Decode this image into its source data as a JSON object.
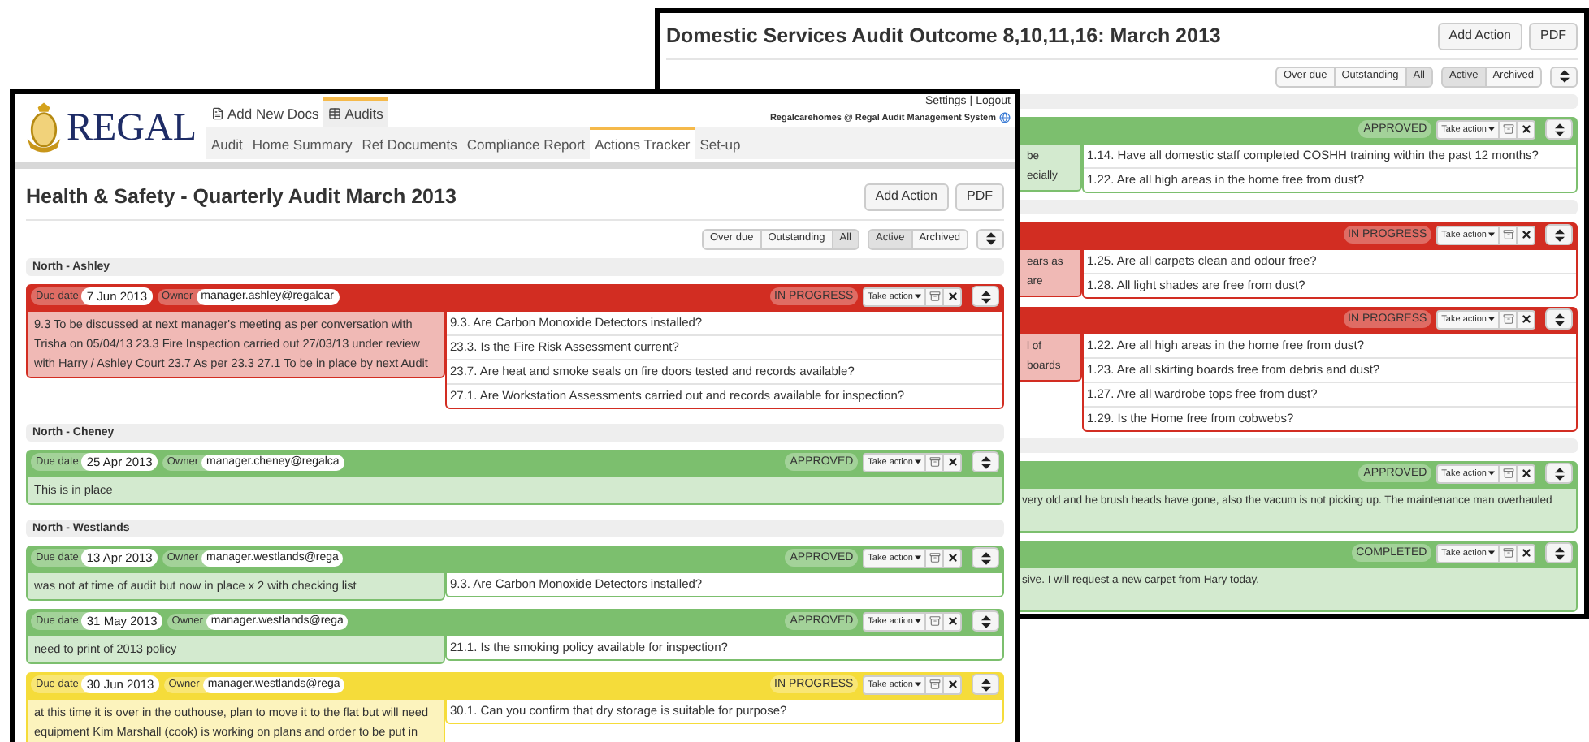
{
  "back_window": {
    "title": "Domestic Services Audit Outcome 8,10,11,16: March 2013",
    "buttons": [
      "Add Action",
      "PDF"
    ],
    "filters": [
      {
        "label": "Over due",
        "selected": false
      },
      {
        "label": "Outstanding",
        "selected": false
      },
      {
        "label": "All",
        "selected": true
      }
    ],
    "status_filters": [
      {
        "label": "Active",
        "selected": true
      },
      {
        "label": "Archived",
        "selected": false
      }
    ],
    "sections": [
      {
        "cards": [
          {
            "color": "#7cbf6e",
            "status": "APPROVED",
            "action_label": "Take action",
            "note_fragments": [
              "be",
              "ecially"
            ],
            "questions": [
              "1.14. Have all domestic staff completed COSHH training within the past 12 months?",
              "1.22. Are all high areas in the home free from dust?"
            ]
          }
        ]
      },
      {
        "cards": [
          {
            "color": "#d22d22",
            "status": "IN PROGRESS",
            "action_label": "Take action",
            "note_fragments": [
              "ears as",
              "are"
            ],
            "questions": [
              "1.25. Are all carpets clean and odour free?",
              "1.28. All light shades are free from dust?"
            ]
          },
          {
            "color": "#d22d22",
            "status": "IN PROGRESS",
            "action_label": "Take action",
            "note_fragments": [
              "l of",
              "boards"
            ],
            "questions": [
              "1.22. Are all high areas in the home free from dust?",
              "1.23. Are all skirting boards free from debris and dust?",
              "1.27. Are all wardrobe tops free from dust?",
              "1.29. Is the Home free from cobwebs?"
            ]
          }
        ]
      },
      {
        "cards": [
          {
            "color": "#7cbf6e",
            "status": "APPROVED",
            "action_label": "Take action",
            "note_fragments": [
              "very old and he brush heads have gone, also the vacum is not picking up. The maintenance man overhauled"
            ]
          },
          {
            "color": "#7cbf6e",
            "status": "COMPLETED",
            "action_label": "Take action",
            "note_fragments": [
              "sive. I will request a new carpet from Hary today."
            ]
          }
        ]
      }
    ]
  },
  "front_window": {
    "logo": "REGAL",
    "top_tabs": [
      {
        "label": "Add New Docs",
        "selected": false
      },
      {
        "label": "Audits",
        "selected": true
      }
    ],
    "nav": [
      {
        "label": "Audit",
        "selected": false
      },
      {
        "label": "Home Summary",
        "selected": false
      },
      {
        "label": "Ref Documents",
        "selected": false
      },
      {
        "label": "Compliance Report",
        "selected": false
      },
      {
        "label": "Actions Tracker",
        "selected": true
      },
      {
        "label": "Set-up",
        "selected": false
      }
    ],
    "settings_link": "Settings",
    "logout_link": "Logout",
    "separator": "|",
    "account": "Regalcarehomes @ Regal Audit Management System",
    "title": "Health & Safety - Quarterly Audit March 2013",
    "buttons": [
      "Add Action",
      "PDF"
    ],
    "filters": [
      {
        "label": "Over due",
        "selected": false
      },
      {
        "label": "Outstanding",
        "selected": false
      },
      {
        "label": "All",
        "selected": true
      }
    ],
    "status_filters": [
      {
        "label": "Active",
        "selected": true
      },
      {
        "label": "Archived",
        "selected": false
      }
    ],
    "sections": [
      {
        "name": "North - Ashley",
        "cards": [
          {
            "color": "#d22d22",
            "due_label": "Due date",
            "due_date": "7 Jun 2013",
            "owner_label": "Owner",
            "owner": "manager.ashley@regalcar",
            "status": "IN PROGRESS",
            "action_label": "Take action",
            "note": "9.3 To be discussed at next manager's meeting as per conversation with Trisha on 05/04/13 23.3 Fire Inspection carried out 27/03/13 under review with Harry / Ashley Court 23.7 As per 23.3 27.1 To be in place by next Audit",
            "questions": [
              "9.3. Are Carbon Monoxide Detectors installed?",
              "23.3. Is the Fire Risk Assessment current?",
              "23.7. Are heat and smoke seals on fire doors tested and records available?",
              "27.1. Are Workstation Assessments carried out and records available for inspection?"
            ]
          }
        ]
      },
      {
        "name": "North - Cheney",
        "cards": [
          {
            "color": "#7cbf6e",
            "due_label": "Due date",
            "due_date": "25 Apr 2013",
            "owner_label": "Owner",
            "owner": "manager.cheney@regalca",
            "status": "APPROVED",
            "action_label": "Take action",
            "note": "This is in place"
          }
        ]
      },
      {
        "name": "North - Westlands",
        "cards": [
          {
            "color": "#7cbf6e",
            "due_label": "Due date",
            "due_date": "13 Apr 2013",
            "owner_label": "Owner",
            "owner": "manager.westlands@rega",
            "status": "APPROVED",
            "action_label": "Take action",
            "note": "was not at time of audit but now in place x 2 with checking list",
            "questions": [
              "9.3. Are Carbon Monoxide Detectors installed?"
            ]
          },
          {
            "color": "#7cbf6e",
            "due_label": "Due date",
            "due_date": "31 May 2013",
            "owner_label": "Owner",
            "owner": "manager.westlands@rega",
            "status": "APPROVED",
            "action_label": "Take action",
            "note": "need to print of 2013 policy",
            "questions": [
              "21.1. Is the smoking policy available for inspection?"
            ]
          },
          {
            "color": "#f5dc3a",
            "due_label": "Due date",
            "due_date": "30 Jun 2013",
            "owner_label": "Owner",
            "owner": "manager.westlands@rega",
            "status": "IN PROGRESS",
            "action_label": "Take action",
            "note": "at this time it is over in the outhouse, plan to move it to the flat but will need equipment Kim Marshall (cook) is working on plans and order to be put in",
            "questions": [
              "30.1. Can you confirm that dry storage is suitable for purpose?"
            ]
          }
        ]
      }
    ]
  }
}
